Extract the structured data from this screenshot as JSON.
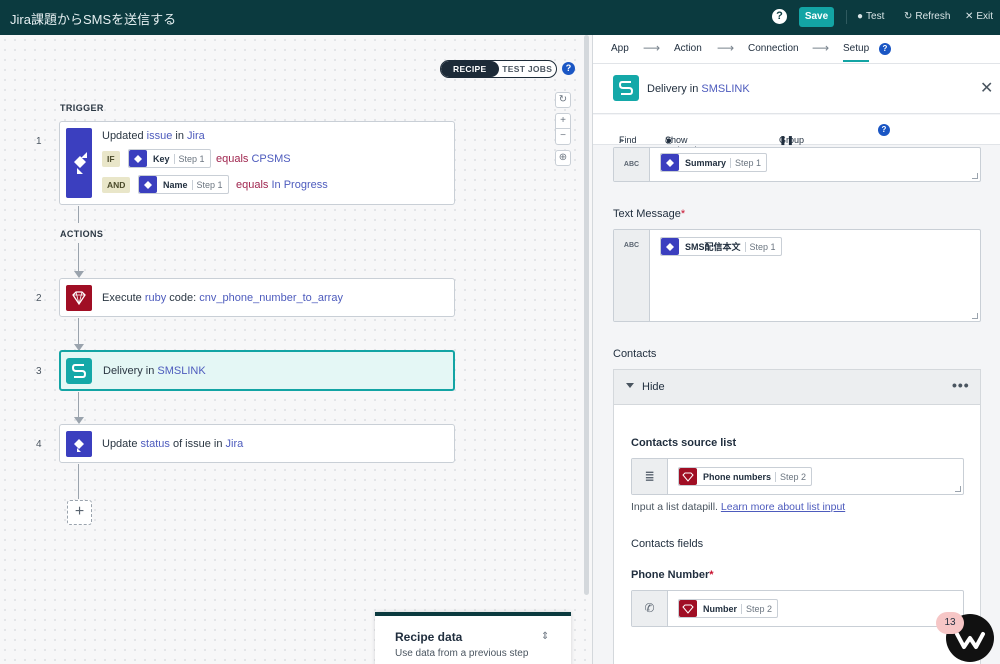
{
  "topbar": {
    "title": "Jira課題からSMSを送信する",
    "help": "?",
    "save": "Save",
    "test": "Test",
    "refresh": "Refresh",
    "exit": "Exit"
  },
  "canvas": {
    "toggle": {
      "recipe": "RECIPE",
      "test_jobs": "TEST JOBS"
    },
    "zoom": {
      "reset": "↻",
      "plus": "+",
      "minus": "−",
      "fit": "⊕"
    },
    "trigger_label": "TRIGGER",
    "actions_label": "ACTIONS",
    "steps": [
      {
        "num": "1",
        "text": [
          "Updated ",
          "issue",
          " in ",
          "Jira"
        ],
        "conditions": [
          {
            "op": "IF",
            "pill": "Key",
            "step": "Step 1",
            "cmp": "equals",
            "value": "CPSMS"
          },
          {
            "op": "AND",
            "pill": "Name",
            "step": "Step 1",
            "cmp": "equals",
            "value": "In Progress"
          }
        ]
      },
      {
        "num": "2",
        "text": [
          "Execute ",
          "ruby",
          " code: ",
          "cnv_phone_number_to_array"
        ]
      },
      {
        "num": "3",
        "text": [
          "Delivery in ",
          "SMSLINK"
        ]
      },
      {
        "num": "4",
        "text": [
          "Update ",
          "status",
          " of issue in ",
          "Jira"
        ]
      }
    ],
    "add": "+",
    "recipe_data": {
      "title": "Recipe data",
      "subtitle": "Use data from a previous step"
    }
  },
  "panel": {
    "crumbs": [
      "App",
      "Action",
      "Connection",
      "Setup"
    ],
    "header": {
      "prefix": "Delivery in ",
      "app": "SMSLINK"
    },
    "tools": {
      "find": "Find",
      "optional": "Show optional fields",
      "group": "Group map data"
    },
    "subject": {
      "gutter": "ABC",
      "pill": "Summary",
      "step": "Step 1"
    },
    "text_message": {
      "label": "Text Message",
      "required": "*",
      "gutter": "ABC",
      "pill": "SMS配信本文",
      "step": "Step 1"
    },
    "contacts": {
      "label": "Contacts",
      "hide": "Hide",
      "dots": "•••",
      "source_label": "Contacts source list",
      "source_pill": "Phone numbers",
      "source_step": "Step 2",
      "hint": "Input a list datapill. ",
      "hint_link": "Learn more about list input",
      "fields_label": "Contacts fields",
      "phone_label": "Phone Number",
      "phone_required": "*",
      "phone_pill": "Number",
      "phone_step": "Step 2"
    }
  },
  "badge": "13"
}
